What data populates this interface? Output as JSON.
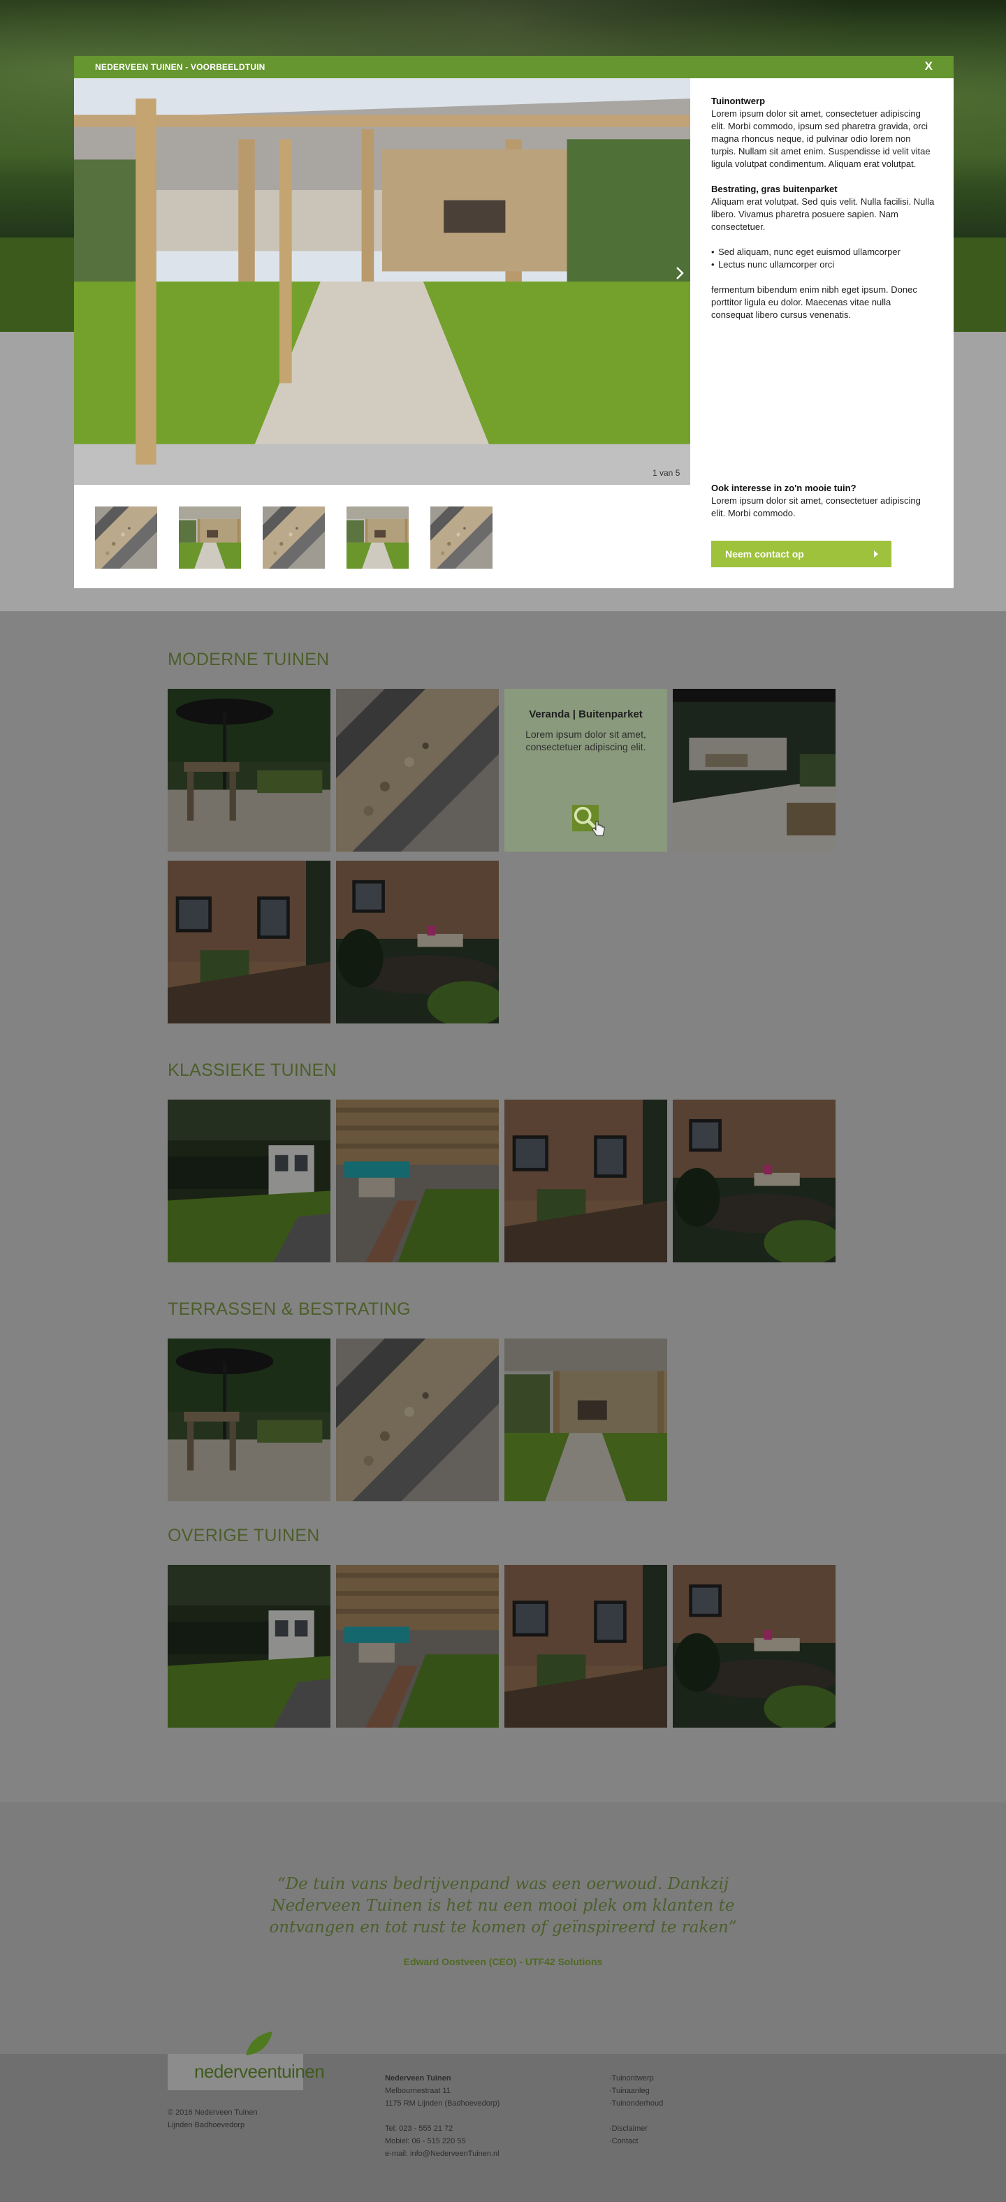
{
  "modal": {
    "title": "NEDERVEEN TUINEN - VOORBEELDTUIN",
    "close_label": "X",
    "counter": "1 van 5",
    "sections": [
      {
        "heading": "Tuinontwerp",
        "text": "Lorem ipsum dolor sit amet, consectetuer adipiscing elit. Morbi commodo, ipsum sed pharetra gravida, orci magna rhoncus neque, id pulvinar odio lorem non turpis. Nullam sit amet enim. Suspendisse id velit vitae ligula volutpat condimentum. Aliquam erat volutpat."
      },
      {
        "heading": "Bestrating, gras buitenparket",
        "text": "Aliquam erat volutpat. Sed quis velit. Nulla facilisi. Nulla libero. Vivamus pharetra posuere sapien. Nam consectetuer."
      }
    ],
    "bullets": [
      "Sed aliquam, nunc eget euismod ullamcorper",
      "Lectus nunc ullamcorper orci"
    ],
    "after_text": "fermentum bibendum enim nibh eget ipsum. Donec porttitor ligula eu dolor. Maecenas vitae nulla consequat libero cursus venenatis.",
    "cta_heading": "Ook interesse in zo'n mooie tuin?",
    "cta_text": "Lorem ipsum dolor sit amet, consectetuer adipiscing elit. Morbi commodo.",
    "cta_button": "Neem contact op"
  },
  "gallery": {
    "sections": [
      {
        "title": "MODERNE TUINEN"
      },
      {
        "title": "KLASSIEKE TUINEN"
      },
      {
        "title": "TERRASSEN & BESTRATING"
      },
      {
        "title": "OVERIGE TUINEN"
      }
    ],
    "hover": {
      "title": "Veranda | Buitenparket",
      "text": "Lorem ipsum dolor sit amet, consectetuer adipiscing elit."
    }
  },
  "testimonial": {
    "quote": "“De tuin vans bedrijvenpand was een oerwoud. Dankzij Nederveen Tuinen is het nu een mooi plek om klanten te ontvangen en tot rust te komen of geïnspireerd te raken”",
    "author": "Edward Oostveen (CEO) - UTF42 Solutions"
  },
  "footer": {
    "logo": "nederveentuinen",
    "copyright": "© 2016 Nederveen Tuinen",
    "location": "Lijnden Badhoevedorp",
    "company": "Nederveen Tuinen",
    "address1": "Melbournestraat 11",
    "address2": "1175 RM Lijnden (Badhoevedorp)",
    "phone": "Tel: 023 - 555 21 72",
    "mobile": "Mobiel: 06 - 515 220 55",
    "email": "e-mail: info@NederveenTuinen.nl",
    "links": [
      "Tuinontwerp",
      "Tuinaanleg",
      "Tuinonderhoud"
    ],
    "links2": [
      "Disclaimer",
      "Contact"
    ]
  },
  "colors": {
    "brand_green": "#669630",
    "cta_green": "#9ec23b",
    "title_green": "#4d5e2a"
  }
}
